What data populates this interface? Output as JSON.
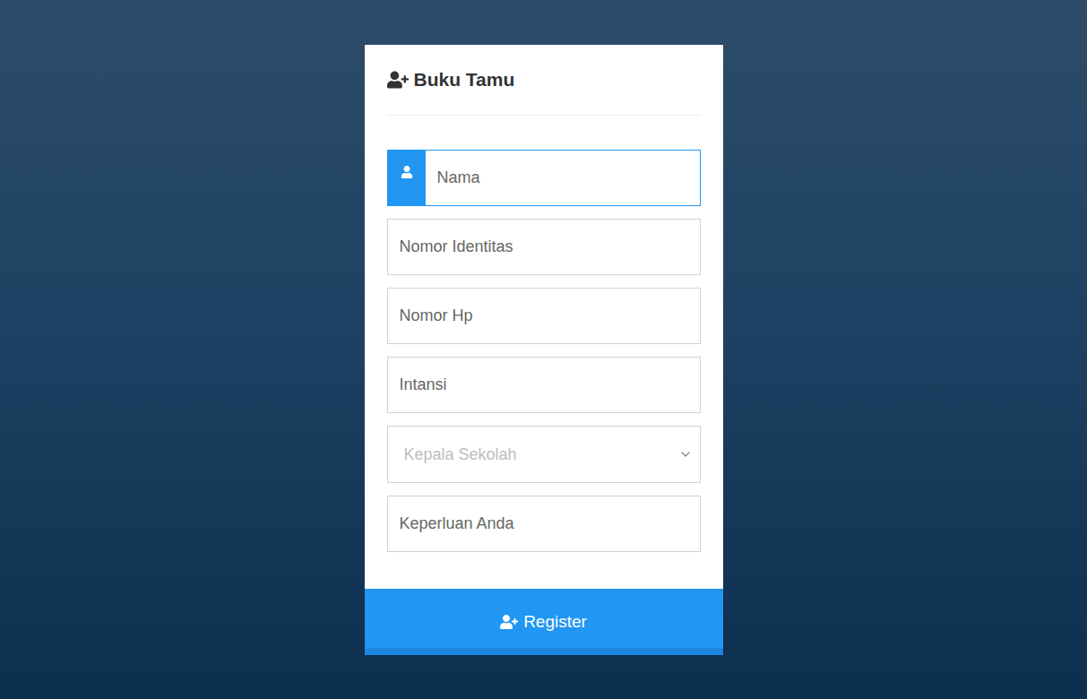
{
  "form": {
    "title": "Buku Tamu"
  },
  "fields": [
    {
      "kind": "input",
      "placeholder": "Nama",
      "focused": true
    },
    {
      "kind": "input",
      "placeholder": "Nomor Identitas",
      "focused": false
    },
    {
      "kind": "input",
      "placeholder": "Nomor Hp",
      "focused": false
    },
    {
      "kind": "input",
      "placeholder": "Intansi",
      "focused": false
    },
    {
      "kind": "select",
      "placeholder": "Kepala Sekolah",
      "focused": false
    },
    {
      "kind": "input",
      "placeholder": "Keperluan Anda",
      "focused": false
    }
  ],
  "submit": {
    "label": "Register"
  }
}
